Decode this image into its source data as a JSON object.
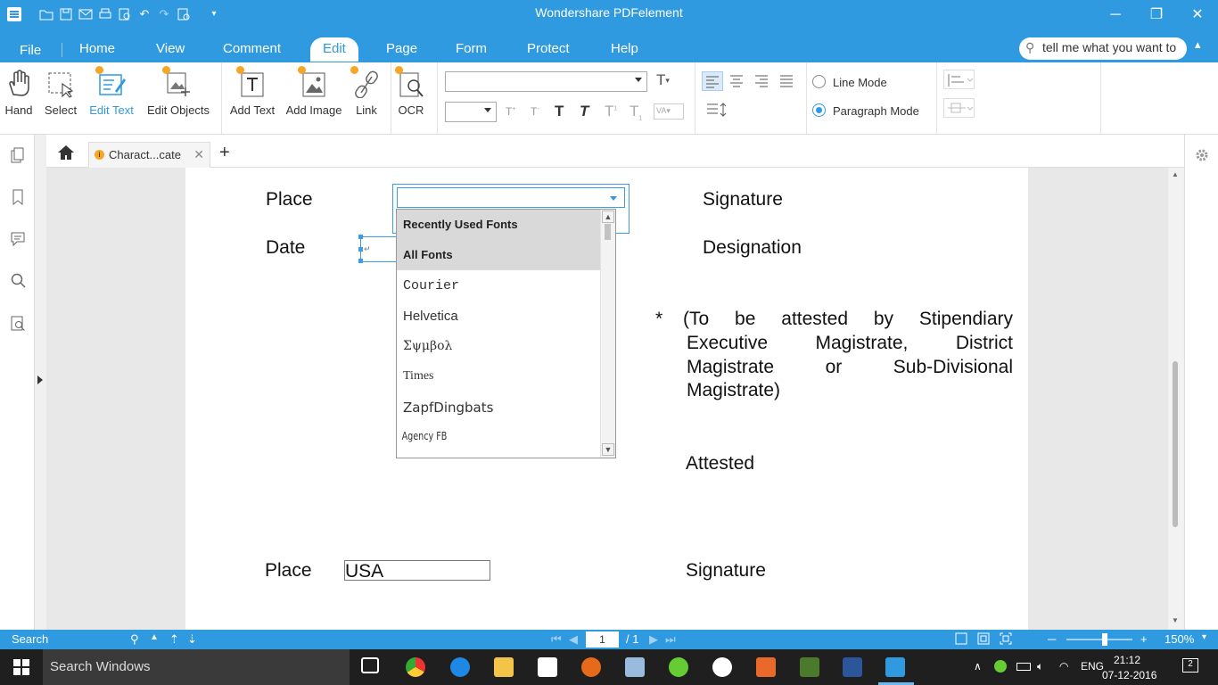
{
  "app": {
    "title": "Wondershare PDFelement",
    "window_controls": [
      "minimize-icon",
      "restore-icon",
      "close-icon"
    ]
  },
  "menu": {
    "items": [
      "File",
      "Home",
      "View",
      "Comment",
      "Edit",
      "Page",
      "Form",
      "Protect",
      "Help"
    ],
    "active": "Edit"
  },
  "search": {
    "placeholder": "tell me what you want to"
  },
  "ribbon": {
    "tools": [
      "Hand",
      "Select",
      "Edit Text",
      "Edit Objects",
      "Add Text",
      "Add Image",
      "Link",
      "OCR"
    ],
    "selected_tool": "Edit Text",
    "modes": {
      "line": "Line Mode",
      "paragraph": "Paragraph Mode",
      "selected": "Paragraph Mode"
    },
    "font_name_value": "",
    "font_size_value": ""
  },
  "tab": {
    "name": "Charact...cate"
  },
  "document": {
    "place1_label": "Place",
    "date_label": "Date",
    "signature1": "Signature",
    "designation": "Designation",
    "asterisk": "*",
    "attest_lines": [
      "(To be attested by Stipendiary",
      "Executive Magistrate, District",
      "Magistrate or Sub-Divisional",
      "Magistrate)"
    ],
    "attested": "Attested",
    "place2_label": "Place",
    "place2_value": "USA",
    "signature2": "Signature"
  },
  "font_dropdown": {
    "current_value": "",
    "items": [
      {
        "label": "Recently Used Fonts",
        "header": true
      },
      {
        "label": "All Fonts",
        "header": true
      },
      {
        "label": "Courier"
      },
      {
        "label": "Helvetica"
      },
      {
        "label": "Σψμβολ"
      },
      {
        "label": "Times"
      },
      {
        "label": "ZapfDingbats"
      },
      {
        "label": "Agency FB"
      }
    ]
  },
  "statusbar": {
    "search_label": "Search",
    "page_current": "1",
    "page_total": "/ 1",
    "zoom": "150%"
  },
  "taskbar": {
    "search_placeholder": "Search Windows",
    "lang": "ENG",
    "time": "21:12",
    "date": "07-12-2016",
    "notifications": "2"
  },
  "colors": {
    "accent": "#2f9ae0",
    "badge": "#f5a623"
  }
}
